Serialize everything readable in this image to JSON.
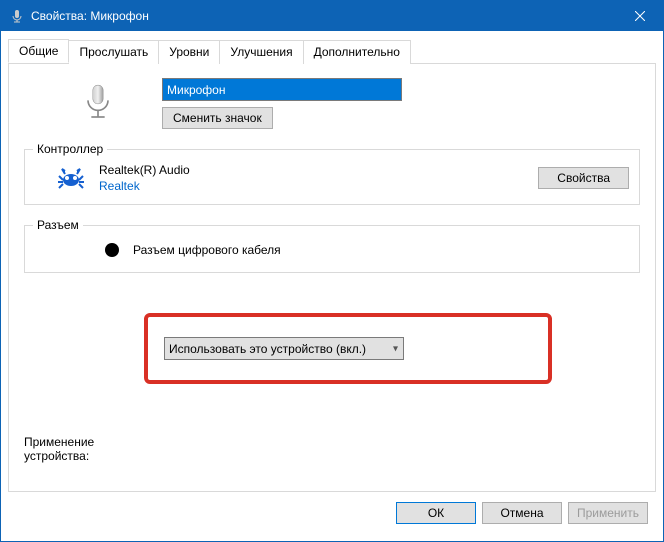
{
  "window": {
    "title": "Свойства: Микрофон"
  },
  "tabs": {
    "general": "Общие",
    "listen": "Прослушать",
    "levels": "Уровни",
    "enhancements": "Улучшения",
    "advanced": "Дополнительно"
  },
  "device": {
    "name_value": "Микрофон",
    "change_icon_btn": "Сменить значок"
  },
  "controller": {
    "legend": "Контроллер",
    "name": "Realtek(R) Audio",
    "vendor": "Realtek",
    "properties_btn": "Свойства"
  },
  "jack": {
    "legend": "Разъем",
    "label": "Разъем цифрового кабеля"
  },
  "usage": {
    "label": "Применение устройства:",
    "selected": "Использовать это устройство (вкл.)"
  },
  "footer": {
    "ok": "ОК",
    "cancel": "Отмена",
    "apply": "Применить"
  }
}
